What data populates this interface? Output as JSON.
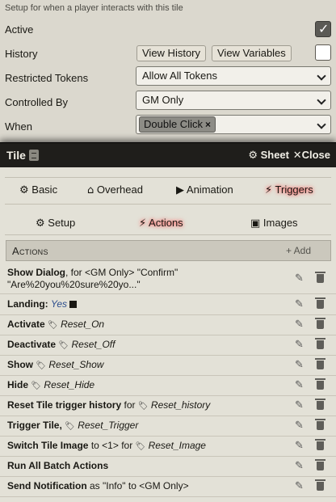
{
  "config": {
    "description": "Setup for when a player interacts with this tile",
    "active_label": "Active",
    "history_label": "History",
    "view_history_label": "View History",
    "view_variables_label": "View Variables",
    "restricted_label": "Restricted Tokens",
    "restricted_value": "Allow All Tokens",
    "controlled_label": "Controlled By",
    "controlled_value": "GM Only",
    "when_label": "When",
    "when_tag": "Double Click",
    "when_tag_remove": "×"
  },
  "window": {
    "title": "Tile",
    "sheet_label": "Sheet",
    "close_label": "Close"
  },
  "tabs_primary": [
    {
      "label": "Basic",
      "icon": "cogs-icon"
    },
    {
      "label": "Overhead",
      "icon": "home-icon"
    },
    {
      "label": "Animation",
      "icon": "play-icon"
    },
    {
      "label": "Triggers",
      "icon": "running-icon",
      "active": true
    }
  ],
  "tabs_secondary": [
    {
      "label": "Setup",
      "icon": "gear-icon"
    },
    {
      "label": "Actions",
      "icon": "running-icon",
      "active": true
    },
    {
      "label": "Images",
      "icon": "image-icon"
    }
  ],
  "actions_header": {
    "title": "Actions",
    "add_label": "Add"
  },
  "actions": [
    {
      "name": "Show Dialog",
      "rest": ", for <GM Only> \"Confirm\"",
      "line2": "\"Are%20you%20sure%20yo...\""
    },
    {
      "name": "Landing:",
      "value": "Yes"
    },
    {
      "name": "Activate",
      "tag": "Reset_On"
    },
    {
      "name": "Deactivate",
      "tag": "Reset_Off"
    },
    {
      "name": "Show",
      "tag": "Reset_Show"
    },
    {
      "name": "Hide",
      "tag": "Reset_Hide"
    },
    {
      "name": "Reset Tile trigger history",
      "mid": "for",
      "tag": "Reset_history"
    },
    {
      "name": "Trigger Tile,",
      "tag": "Reset_Trigger"
    },
    {
      "name": "Switch Tile Image",
      "mid": "to <1> for",
      "tag": "Reset_Image"
    },
    {
      "name": "Run All Batch Actions"
    },
    {
      "name": "Send Notification",
      "rest": " as \"Info\" to <GM Only>"
    }
  ]
}
